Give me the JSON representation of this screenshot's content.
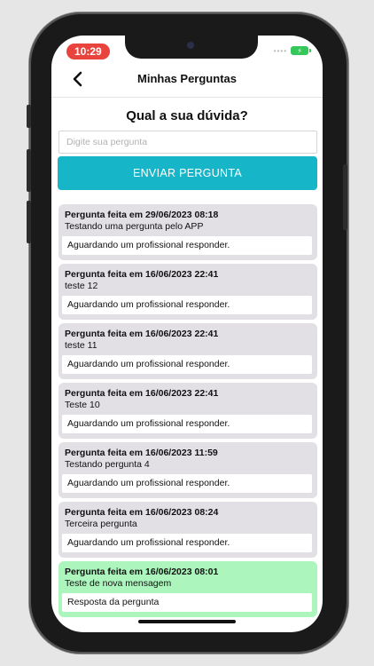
{
  "status_bar": {
    "time": "10:29",
    "dots": "••••"
  },
  "nav": {
    "title": "Minhas Perguntas"
  },
  "form": {
    "heading": "Qual a sua dúvida?",
    "placeholder": "Digite sua pergunta",
    "value": "",
    "send_label": "ENVIAR PERGUNTA"
  },
  "questions": [
    {
      "date": "Pergunta feita em 29/06/2023 08:18",
      "text": "Testando uma pergunta pelo APP",
      "reply": "Aguardando um profissional responder."
    },
    {
      "date": "Pergunta feita em 16/06/2023 22:41",
      "text": "teste 12",
      "reply": "Aguardando um profissional responder."
    },
    {
      "date": "Pergunta feita em 16/06/2023 22:41",
      "text": "teste 11",
      "reply": "Aguardando um profissional responder."
    },
    {
      "date": "Pergunta feita em 16/06/2023 22:41",
      "text": "Teste 10",
      "reply": "Aguardando um profissional responder."
    },
    {
      "date": "Pergunta feita em 16/06/2023 11:59",
      "text": "Testando pergunta 4",
      "reply": "Aguardando um profissional responder."
    },
    {
      "date": "Pergunta feita em 16/06/2023 08:24",
      "text": "Terceira pergunta",
      "reply": "Aguardando um profissional responder."
    },
    {
      "date": "Pergunta feita em 16/06/2023 08:01",
      "text": "Teste de nova mensagem",
      "reply": "Resposta da pergunta"
    }
  ],
  "colors": {
    "accent": "#17b5c8",
    "card_pending": "#e2dfe5",
    "card_answered": "#acf5bc",
    "time_pill": "#e8433c",
    "battery": "#35c759"
  },
  "icons": {
    "back": "chevron-left-icon",
    "battery": "battery-charging-icon"
  }
}
